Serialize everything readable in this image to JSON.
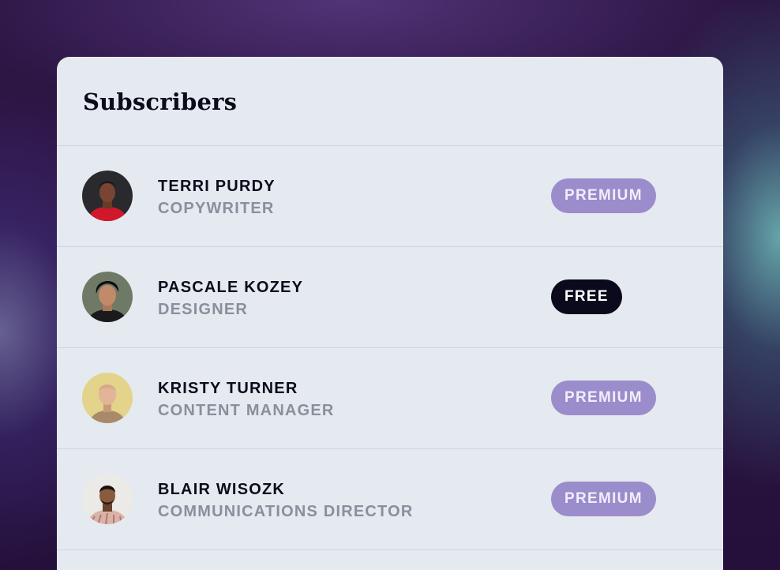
{
  "card": {
    "title": "Subscribers"
  },
  "subscribers": [
    {
      "name": "TERRI PURDY",
      "role": "COPYWRITER",
      "plan": "PREMIUM"
    },
    {
      "name": "PASCALE KOZEY",
      "role": "DESIGNER",
      "plan": "FREE"
    },
    {
      "name": "KRISTY TURNER",
      "role": "CONTENT MANAGER",
      "plan": "PREMIUM"
    },
    {
      "name": "BLAIR WISOZK",
      "role": "COMMUNICATIONS DIRECTOR",
      "plan": "PREMIUM"
    }
  ],
  "colors": {
    "premium_badge": "#9b8ccb",
    "free_badge": "#0a0a1c",
    "card_background": "#e5e9f0"
  }
}
